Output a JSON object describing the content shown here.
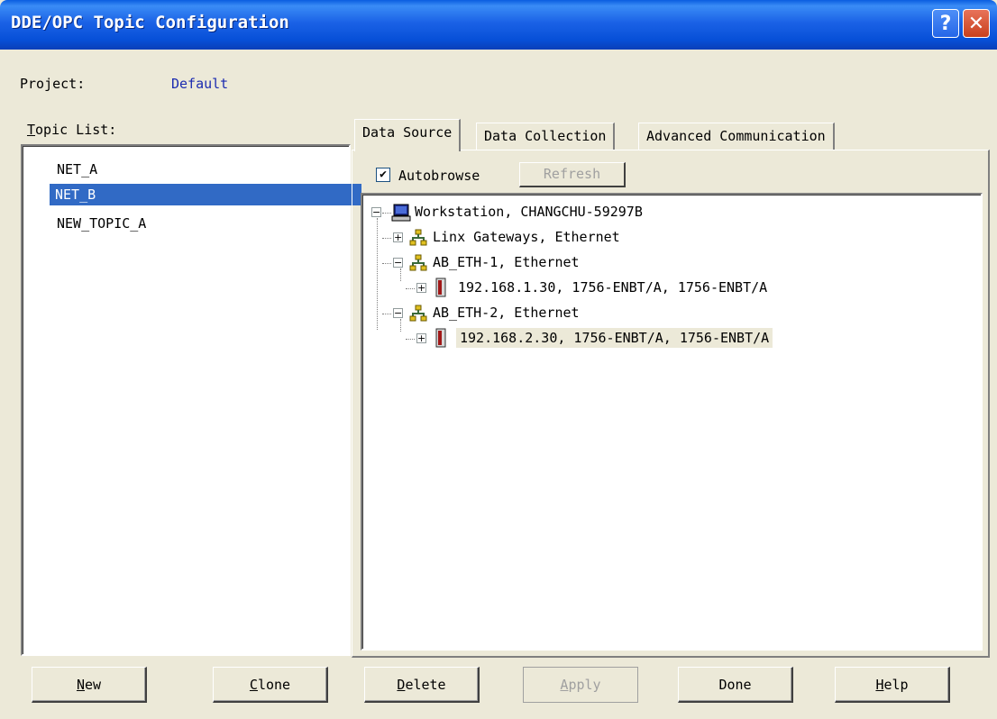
{
  "window": {
    "title": "DDE/OPC Topic Configuration",
    "help_icon": "help-question-icon",
    "close_icon": "close-x-icon"
  },
  "project": {
    "label": "Project:",
    "value": "Default"
  },
  "topic_list": {
    "label_accel": "T",
    "label_rest": "opic List:",
    "items": [
      "NET_A",
      "NET_B",
      "NEW_TOPIC_A"
    ],
    "selected": "NET_B"
  },
  "tabs": [
    {
      "label": "Data Source",
      "active": true
    },
    {
      "label": "Data Collection",
      "active": false
    },
    {
      "label": "Advanced Communication",
      "active": false
    }
  ],
  "data_source": {
    "autobrowse_label": "Autobrowse",
    "autobrowse_checked": true,
    "autobrowse_mark": "✔",
    "refresh_label": "Refresh",
    "tree": [
      {
        "label": "Workstation, CHANGCHU-59297B",
        "icon": "workstation-icon",
        "expander": "−"
      },
      {
        "label": "Linx Gateways, Ethernet",
        "icon": "network-icon",
        "expander": "+"
      },
      {
        "label": "AB_ETH-1, Ethernet",
        "icon": "network-icon",
        "expander": "−"
      },
      {
        "label": "192.168.1.30, 1756-ENBT/A, 1756-ENBT/A",
        "icon": "module-icon",
        "expander": "+"
      },
      {
        "label": "AB_ETH-2, Ethernet",
        "icon": "network-icon",
        "expander": "−"
      },
      {
        "label": "192.168.2.30, 1756-ENBT/A, 1756-ENBT/A",
        "icon": "module-icon",
        "expander": "+",
        "highlighted": true
      }
    ]
  },
  "buttons": {
    "new": {
      "accel": "N",
      "rest": "ew"
    },
    "clone": {
      "accel": "C",
      "rest": "lone"
    },
    "delete": {
      "accel": "D",
      "rest": "elete"
    },
    "apply": {
      "accel": "A",
      "rest": "pply",
      "disabled": true
    },
    "done": {
      "label": "Done"
    },
    "help": {
      "accel": "H",
      "rest": "elp"
    }
  },
  "colors": {
    "titlebar": "#0a5de0",
    "selection": "#316ac5",
    "project_value": "#1c2cb0",
    "dialog_bg": "#ece9d8"
  }
}
